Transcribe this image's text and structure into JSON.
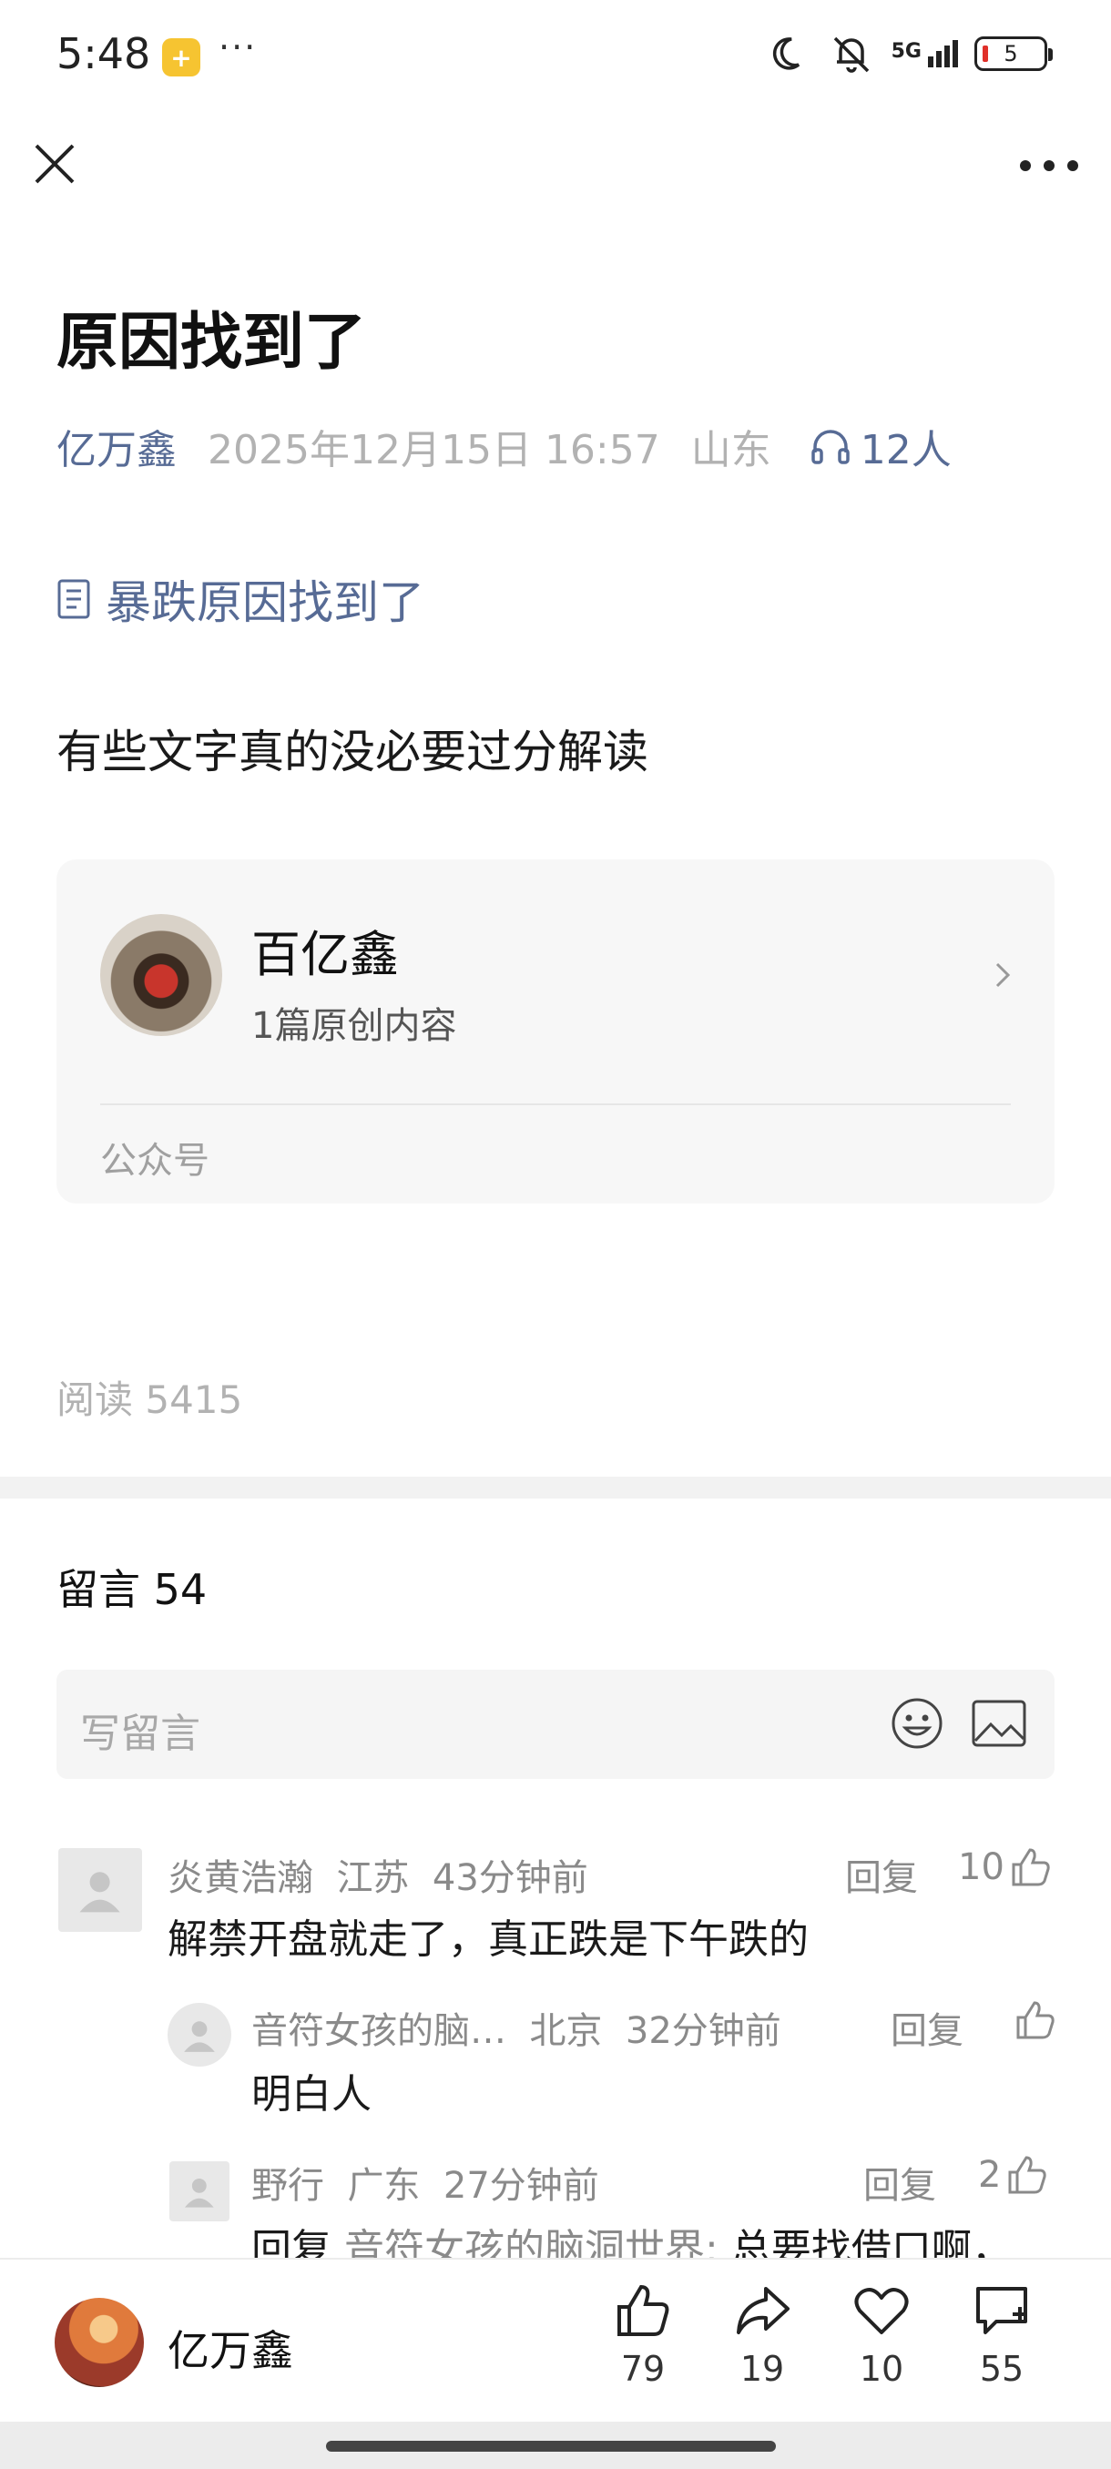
{
  "status_bar": {
    "time": "5:48",
    "dots": "···",
    "network": "5G",
    "battery": "5"
  },
  "article": {
    "title": "原因找到了",
    "author": "亿万鑫",
    "date": "2025年12月15日 16:57",
    "location": "山东",
    "listeners": "12人",
    "tag": "暴跌原因找到了",
    "body": "有些文字真的没必要过分解读"
  },
  "account_card": {
    "name": "百亿鑫",
    "sub": "1篇原创内容",
    "type": "公众号"
  },
  "read_count": "阅读 5415",
  "comments": {
    "title": "留言 54",
    "input_placeholder": "写留言",
    "items": [
      {
        "author": "炎黄浩瀚",
        "location": "江苏",
        "time": "43分钟前",
        "reply_label": "回复",
        "likes": "10",
        "text": "解禁开盘就走了，真正跌是下午跌的",
        "replies": [
          {
            "author": "音符女孩的脑…",
            "location": "北京",
            "time": "32分钟前",
            "reply_label": "回复",
            "likes": "",
            "text": "明白人"
          },
          {
            "author": "野行",
            "location": "广东",
            "time": "27分钟前",
            "reply_label": "回复",
            "likes": "2",
            "text_prefix": "回复 ",
            "text_mention": "音符女孩的脑洞世界:",
            "text": " 总要找借口啊，"
          }
        ]
      }
    ]
  },
  "bottom_bar": {
    "author": "亿万鑫",
    "like_count": "79",
    "share_count": "19",
    "favorite_count": "10",
    "comment_count": "55"
  }
}
